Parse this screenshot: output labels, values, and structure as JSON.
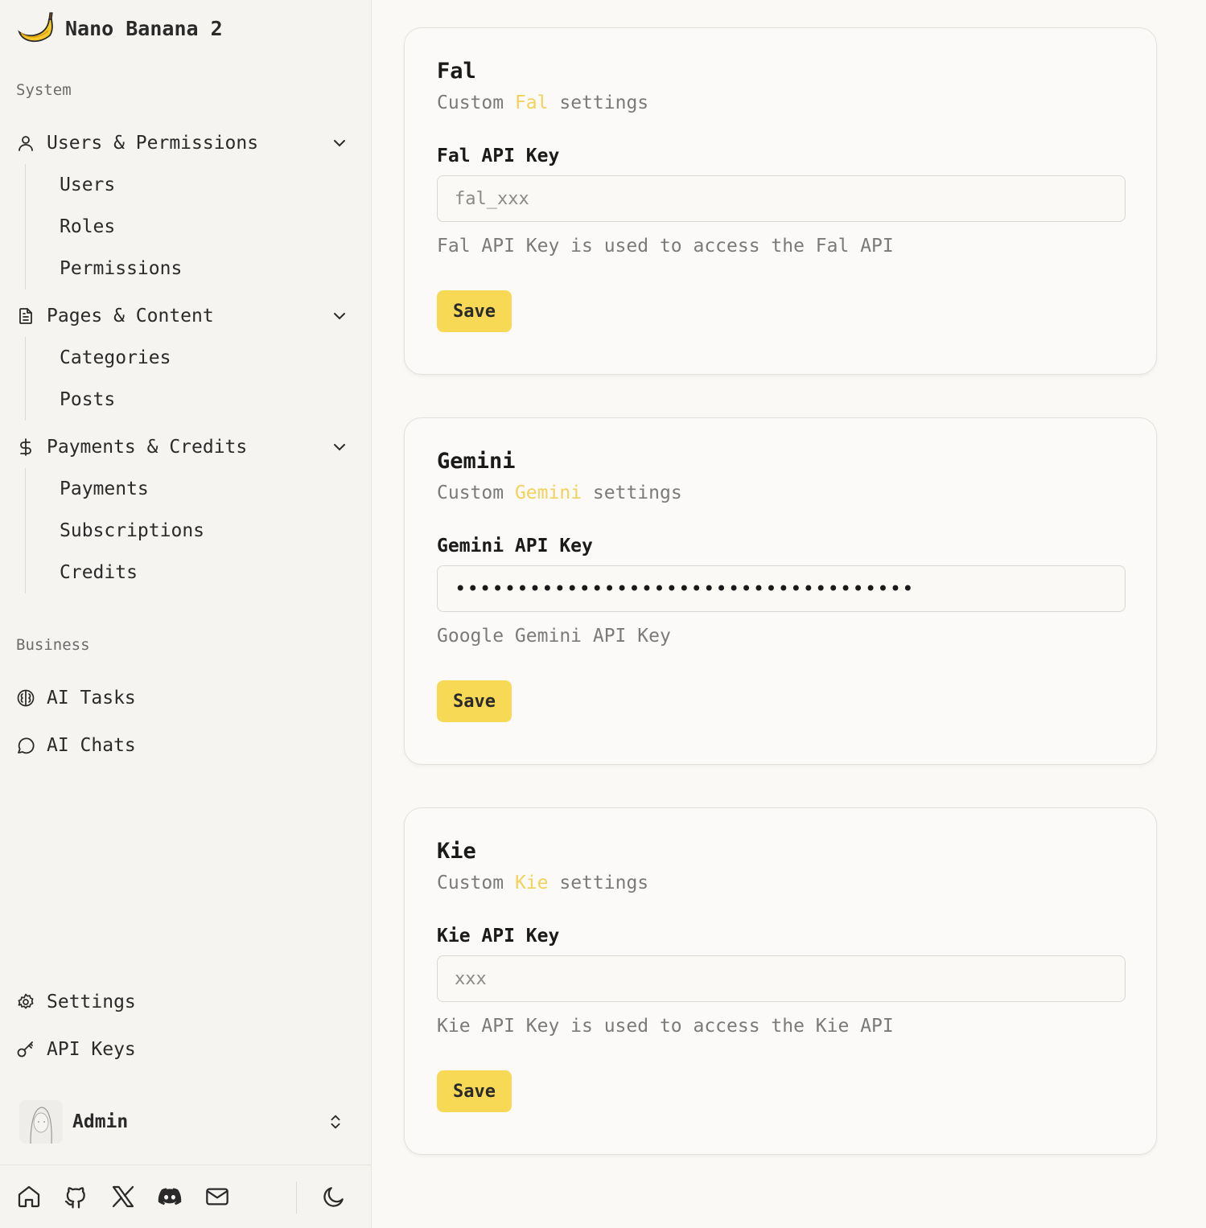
{
  "brand": {
    "name": "Nano Banana 2",
    "logo_icon": "banana-icon"
  },
  "sidebar": {
    "system_label": "System",
    "business_label": "Business",
    "groups": [
      {
        "label": "Users & Permissions",
        "icon": "user-icon",
        "items": [
          "Users",
          "Roles",
          "Permissions"
        ]
      },
      {
        "label": "Pages & Content",
        "icon": "file-text-icon",
        "items": [
          "Categories",
          "Posts"
        ]
      },
      {
        "label": "Payments & Credits",
        "icon": "dollar-icon",
        "items": [
          "Payments",
          "Subscriptions",
          "Credits"
        ]
      }
    ],
    "business_items": [
      {
        "label": "AI Tasks",
        "icon": "brain-icon"
      },
      {
        "label": "AI Chats",
        "icon": "chat-bubble-icon"
      }
    ],
    "bottom_items": [
      {
        "label": "Settings",
        "icon": "gear-icon"
      },
      {
        "label": "API Keys",
        "icon": "key-icon"
      }
    ],
    "user": {
      "name": "Admin"
    },
    "footer_icons": [
      "home-icon",
      "github-icon",
      "x-icon",
      "discord-icon",
      "mail-icon",
      "moon-icon"
    ]
  },
  "cards": [
    {
      "title": "Fal",
      "sub_prefix": "Custom",
      "sub_highlight": "Fal",
      "sub_suffix": "settings",
      "field_label": "Fal API Key",
      "placeholder": "fal_xxx",
      "value": "",
      "help": "Fal API Key is used to access the Fal API",
      "save_label": "Save"
    },
    {
      "title": "Gemini",
      "sub_prefix": "Custom",
      "sub_highlight": "Gemini",
      "sub_suffix": "settings",
      "field_label": "Gemini API Key",
      "placeholder": "",
      "value": "•••••••••••••••••••••••••••••••••••••",
      "help": "Google Gemini API Key",
      "save_label": "Save"
    },
    {
      "title": "Kie",
      "sub_prefix": "Custom",
      "sub_highlight": "Kie",
      "sub_suffix": "settings",
      "field_label": "Kie API Key",
      "placeholder": "xxx",
      "value": "",
      "help": "Kie API Key is used to access the Kie API",
      "save_label": "Save"
    }
  ],
  "colors": {
    "accent": "#f7d955",
    "highlight_text": "#f2d25a",
    "background": "#faf9f6",
    "sidebar_bg": "#f5f4f1"
  }
}
